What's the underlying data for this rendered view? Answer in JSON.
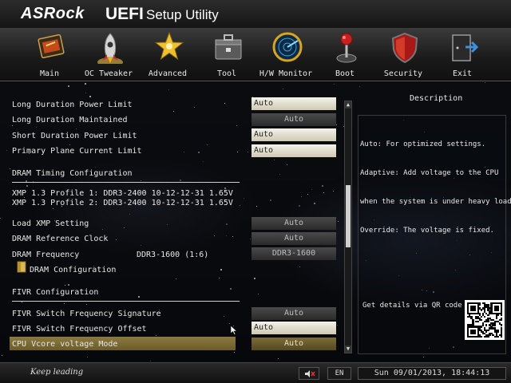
{
  "header": {
    "brand": "ASRock",
    "uefi": "UEFI",
    "subtitle": "Setup Utility"
  },
  "menu": {
    "tabs": [
      {
        "label": "Main",
        "icon": "main-icon"
      },
      {
        "label": "OC Tweaker",
        "icon": "rocket-icon"
      },
      {
        "label": "Advanced",
        "icon": "star-icon"
      },
      {
        "label": "Tool",
        "icon": "toolbox-icon"
      },
      {
        "label": "H/W Monitor",
        "icon": "radar-icon"
      },
      {
        "label": "Boot",
        "icon": "joystick-icon"
      },
      {
        "label": "Security",
        "icon": "shield-icon"
      },
      {
        "label": "Exit",
        "icon": "exit-door-icon"
      }
    ],
    "active_tab": "OC Tweaker"
  },
  "settings": {
    "long_duration_power_limit": {
      "label": "Long Duration Power Limit",
      "value": "Auto"
    },
    "long_duration_maintained": {
      "label": "Long Duration Maintained",
      "value": "Auto"
    },
    "short_duration_power_limit": {
      "label": "Short Duration Power Limit",
      "value": "Auto"
    },
    "primary_plane_current_limit": {
      "label": "Primary Plane Current Limit",
      "value": "Auto"
    },
    "dram_timing_heading": "DRAM Timing Configuration",
    "xmp_profile_1": "XMP 1.3 Profile 1: DDR3-2400 10-12-12-31 1.65V",
    "xmp_profile_2": "XMP 1.3 Profile 2: DDR3-2400 10-12-12-31 1.65V",
    "load_xmp_setting": {
      "label": "Load XMP Setting",
      "value": "Auto"
    },
    "dram_reference_clock": {
      "label": "DRAM Reference Clock",
      "value": "Auto"
    },
    "dram_frequency": {
      "label": "DRAM Frequency",
      "current": "DDR3-1600 (1:6)",
      "value": "DDR3-1600"
    },
    "dram_configuration": "DRAM Configuration",
    "fivr_heading": "FIVR Configuration",
    "fivr_switch_frequency_signature": {
      "label": "FIVR Switch Frequency Signature",
      "value": "Auto"
    },
    "fivr_switch_frequency_offset": {
      "label": "FIVR Switch Frequency Offset",
      "value": "Auto"
    },
    "cpu_vcore_voltage_mode": {
      "label": "CPU Vcore voltage Mode",
      "value": "Auto"
    }
  },
  "description": {
    "title": "Description",
    "lines": [
      "Auto: For optimized settings.",
      "Adaptive: Add voltage to the CPU",
      "when the system is under heavy load.",
      "Override: The voltage is fixed."
    ],
    "qr_label": "Get details via QR code"
  },
  "footer": {
    "tagline": "Keep leading",
    "language": "EN",
    "datetime": "Sun 09/01/2013, 18:44:13"
  },
  "scrollbar": {
    "up": "▲",
    "down": "▼"
  }
}
